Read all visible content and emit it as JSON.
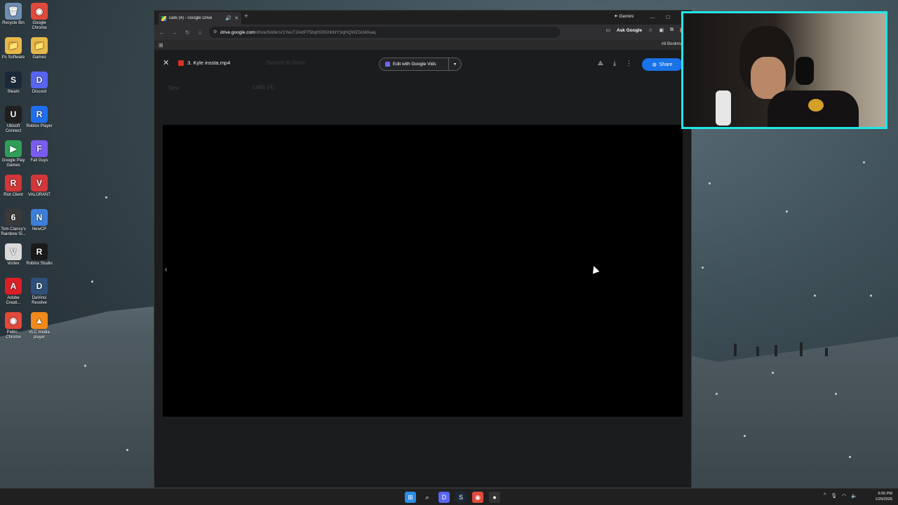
{
  "desktop": {
    "icons": [
      {
        "label": "Recycle Bin",
        "glyph": "🗑",
        "color": "#6f8fb0"
      },
      {
        "label": "Google Chrome",
        "glyph": "◉",
        "color": "#e04a3b"
      },
      {
        "label": "Pc Software",
        "glyph": "📁",
        "color": "#e8b84a"
      },
      {
        "label": "Games",
        "glyph": "📁",
        "color": "#e8b84a"
      },
      {
        "label": "Steam",
        "glyph": "S",
        "color": "#1b2838"
      },
      {
        "label": "Discord",
        "glyph": "D",
        "color": "#5865f2"
      },
      {
        "label": "Ubisoft Connect",
        "glyph": "U",
        "color": "#1f1f1f"
      },
      {
        "label": "Roblox Player",
        "glyph": "R",
        "color": "#1e6ff0"
      },
      {
        "label": "Google Play Games",
        "glyph": "▶",
        "color": "#2f9e58"
      },
      {
        "label": "Fall Guys",
        "glyph": "F",
        "color": "#7a5cf0"
      },
      {
        "label": "Riot Client",
        "glyph": "R",
        "color": "#d13639"
      },
      {
        "label": "VALORANT",
        "glyph": "V",
        "color": "#d13639"
      },
      {
        "label": "Tom Clancy's Rainbow Si...",
        "glyph": "6",
        "color": "#3a3a3a"
      },
      {
        "label": "NewCP",
        "glyph": "N",
        "color": "#3d7fd8"
      },
      {
        "label": "Vortex",
        "glyph": "V",
        "color": "#d9d9d9"
      },
      {
        "label": "Roblox Studio",
        "glyph": "R",
        "color": "#1a1a1a"
      },
      {
        "label": "Adobe Creati...",
        "glyph": "A",
        "color": "#da1f26"
      },
      {
        "label": "DaVinci Resolve",
        "glyph": "D",
        "color": "#2d4f7a"
      },
      {
        "label": "Pablo - Chrome",
        "glyph": "◉",
        "color": "#e04a3b"
      },
      {
        "label": "VLC media player",
        "glyph": "▲",
        "color": "#f08a1b"
      }
    ]
  },
  "browser": {
    "tab_title": "calls (4) - Google Drive",
    "tab_close": "✕",
    "tab_audio": "🔊",
    "new_tab": "+",
    "gemini_label": "✦ Gemini",
    "win_min": "—",
    "win_max": "☐",
    "win_close": "✕",
    "nav_back": "←",
    "nav_forward": "→",
    "nav_reload": "↻",
    "nav_home": "⌂",
    "url_host": "drive.google.com",
    "url_path": "/drive/folders/1YeuT2AdP75bqh59GhbNY3qHQWZ3oWAaq",
    "ask_google": "Ask Google",
    "bookmark_star": "☆",
    "all_bookmarks": "All Bookmarks",
    "apps_icon": "⊞"
  },
  "viewer": {
    "close": "✕",
    "file_name": "3. Kyle inssta.mp4",
    "edit_label": "Edit with Google Vids",
    "edit_dropdown": "▾",
    "share_label": "Share",
    "more": "⋮",
    "download": "⤓",
    "add_drive": "⟁",
    "prev": "‹"
  },
  "drive_ghost": {
    "search_placeholder": "Search in Drive",
    "folder_title": "calls (4)",
    "new_label": "New"
  },
  "taskbar": {
    "apps": [
      {
        "name": "windows-start",
        "glyph": "⊞",
        "color": "#2b8de6"
      },
      {
        "name": "search",
        "glyph": "⌕",
        "color": "#202020"
      },
      {
        "name": "discord",
        "glyph": "D",
        "color": "#5865f2"
      },
      {
        "name": "steam",
        "glyph": "S",
        "color": "#1b2838"
      },
      {
        "name": "chrome",
        "glyph": "◉",
        "color": "#e04a3b"
      },
      {
        "name": "obs",
        "glyph": "●",
        "color": "#333333"
      }
    ],
    "tray_chevron": "^",
    "time": "6:05 PM",
    "date": "1/29/2026"
  },
  "colors": {
    "webcam_border": "#21e6e6",
    "share_blue": "#1a73e8"
  }
}
